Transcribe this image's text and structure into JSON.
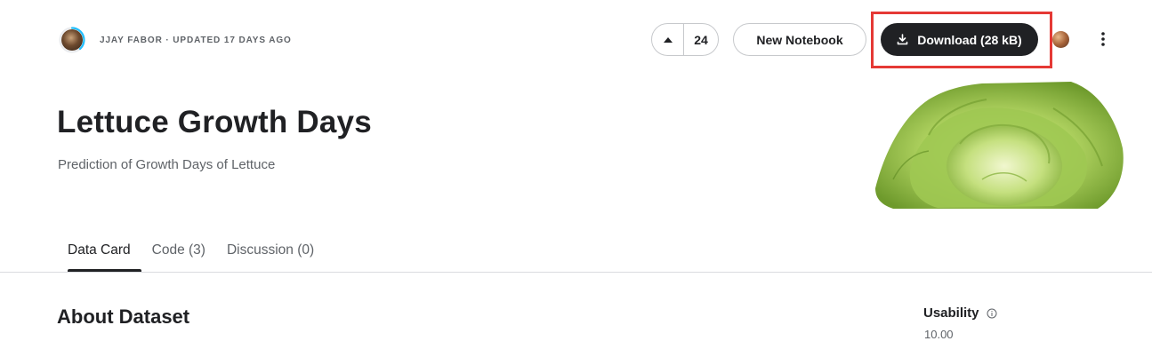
{
  "header": {
    "author_line": "JJAY FABOR · UPDATED 17 DAYS AGO",
    "vote_count": "24",
    "new_notebook_label": "New Notebook",
    "download_label": "Download (28 kB)",
    "more_icon": "more-vertical-icon",
    "upvote_icon": "upvote-arrow-icon",
    "download_icon": "download-icon"
  },
  "dataset": {
    "title": "Lettuce Growth Days",
    "subtitle": "Prediction of Growth Days of Lettuce"
  },
  "tabs": [
    {
      "label": "Data Card",
      "active": true
    },
    {
      "label": "Code (3)",
      "active": false
    },
    {
      "label": "Discussion (0)",
      "active": false
    }
  ],
  "about": {
    "heading": "About Dataset",
    "usability_label": "Usability",
    "usability_value": "10.00"
  },
  "colors": {
    "download_bg": "#202124",
    "highlight": "#e53935",
    "progress_ring": "#20beff"
  }
}
